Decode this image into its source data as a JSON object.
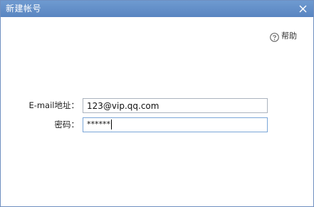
{
  "window": {
    "title": "新建帐号",
    "colors": {
      "titlebar": "#5f8bc6",
      "border": "#6f8fc0",
      "input_border": "#abb3be",
      "input_focus_border": "#7aa6d8"
    },
    "close_icon": "close-icon"
  },
  "help": {
    "icon": "help-circle-icon",
    "label": "帮助"
  },
  "form": {
    "email_label": "E-mail地址：",
    "email_value": "123@vip.qq.com",
    "password_label": "密码：",
    "password_mask": "******"
  }
}
